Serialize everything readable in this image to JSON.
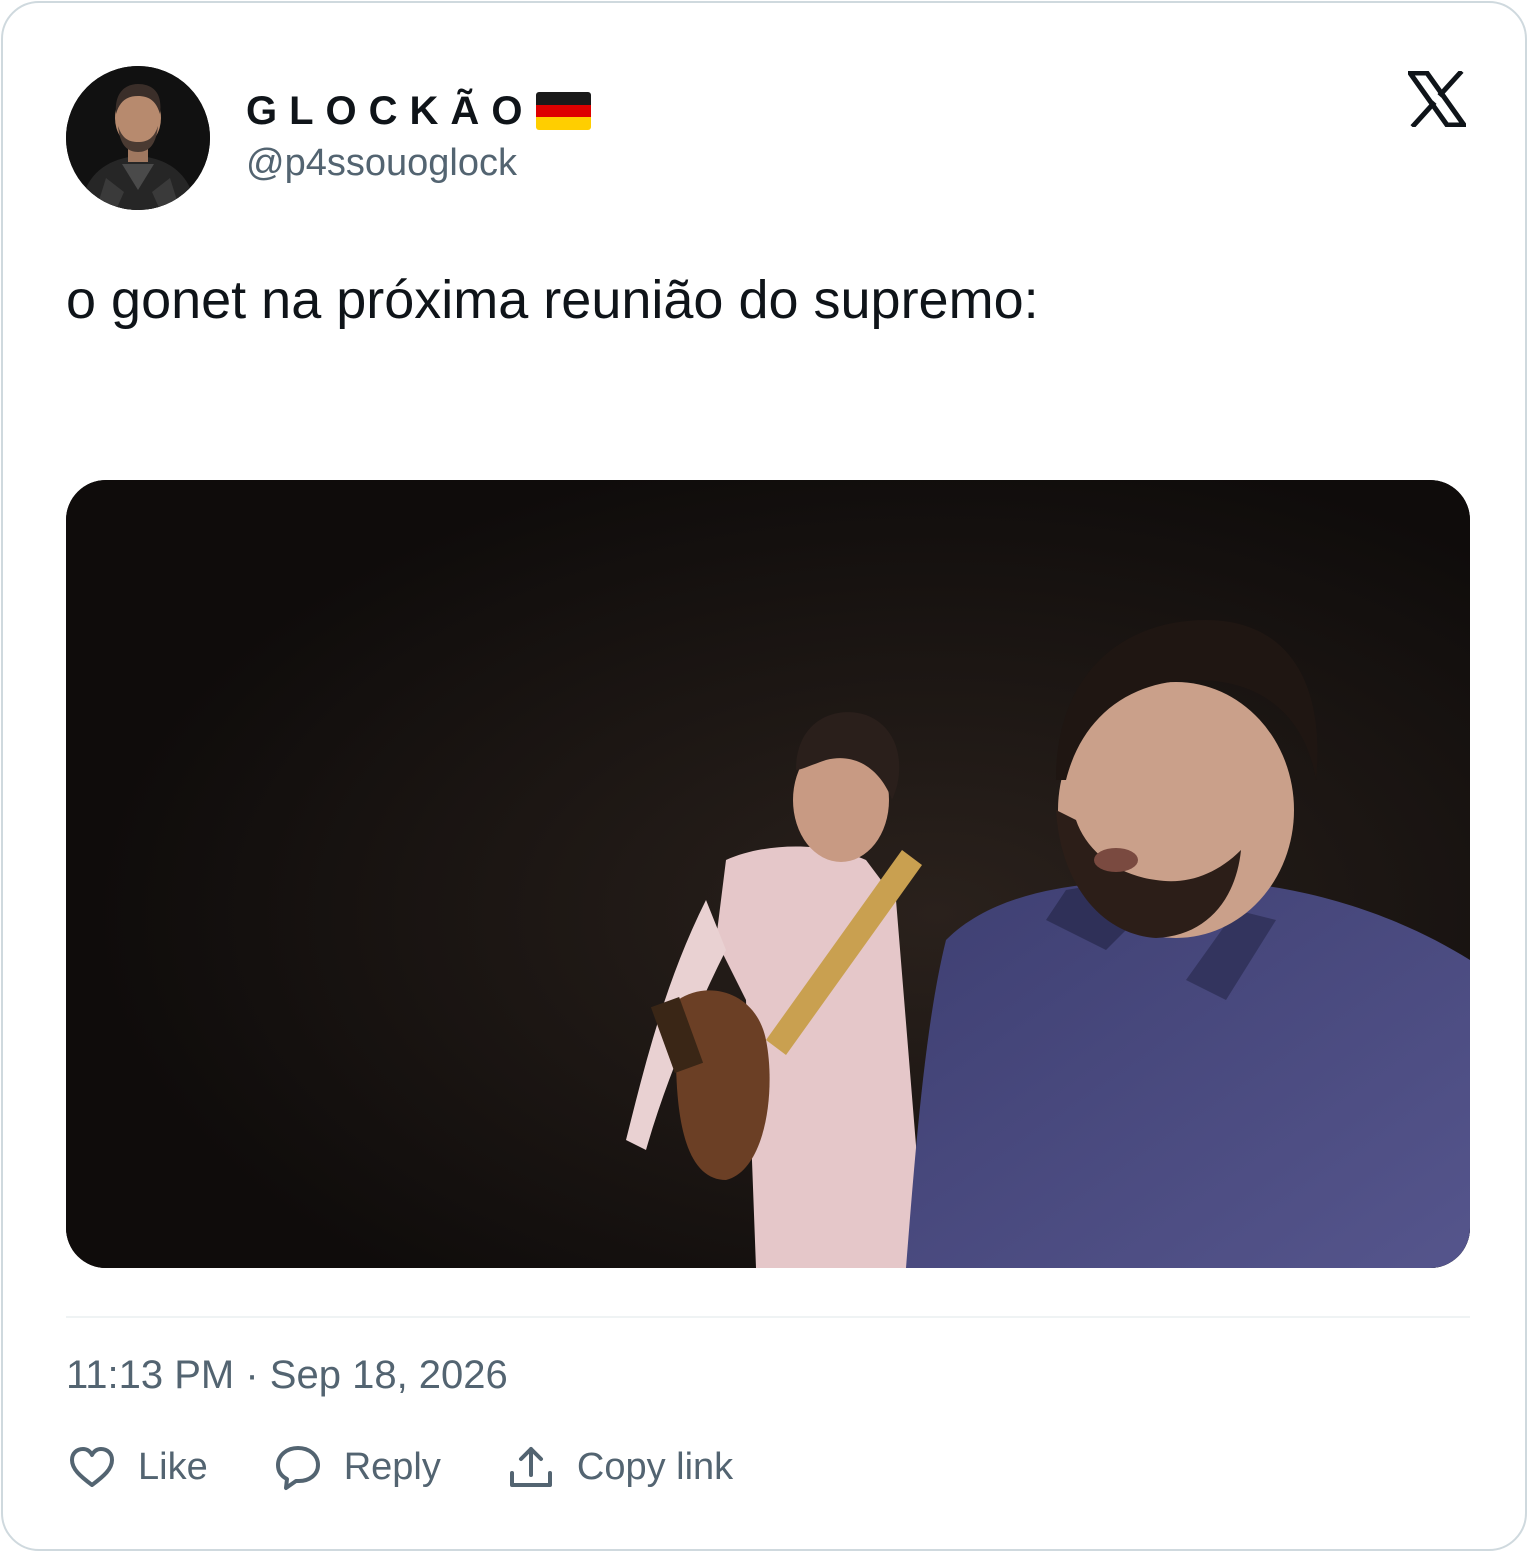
{
  "author": {
    "display_name": "GLOCKÃO",
    "handle": "@p4ssouoglock"
  },
  "icons": {
    "flag": "germany-flag-icon",
    "platform": "x-logo-icon",
    "like": "heart-icon",
    "reply": "speech-bubble-icon",
    "copy": "upload-icon"
  },
  "tweet": {
    "text": "o gonet na próxima reunião do supremo:",
    "timestamp": "11:13 PM · Sep 18, 2026"
  },
  "actions": {
    "like_label": "Like",
    "reply_label": "Reply",
    "copy_label": "Copy link"
  },
  "colors": {
    "text_primary": "#0f1419",
    "text_secondary": "#536471",
    "border": "#cfd9de"
  }
}
